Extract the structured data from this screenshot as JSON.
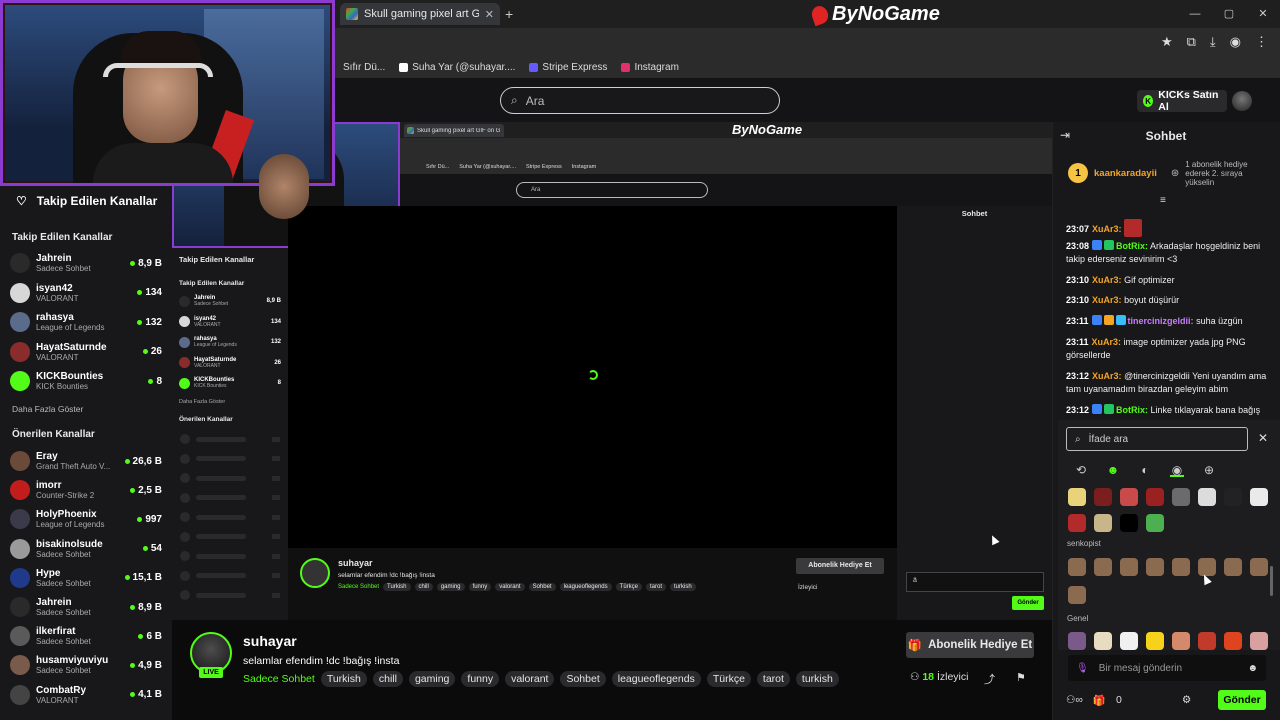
{
  "browser": {
    "tab_title": "Skull gaming pixel art GIF on G",
    "new_tab": "+",
    "brand": "ByNoGame",
    "bookmarks": [
      "Sıfır Dü...",
      "Suha Yar (@suhayar....",
      "Stripe Express",
      "Instagram"
    ],
    "window_controls": [
      "—",
      "▢",
      "✕"
    ]
  },
  "header": {
    "search_placeholder": "Ara",
    "kicks_button": "KICKs Satın Al"
  },
  "sidebar": {
    "title": "Takip Edilen Kanallar",
    "followed_label": "Takip Edilen Kanallar",
    "followed": [
      {
        "name": "Jahrein",
        "category": "Sadece Sohbet",
        "viewers": "8,9 B",
        "color": "#2a2a2a"
      },
      {
        "name": "isyan42",
        "category": "VALORANT",
        "viewers": "134",
        "color": "#d7d7d7"
      },
      {
        "name": "rahasya",
        "category": "League of Legends",
        "viewers": "132",
        "color": "#5a6b8c"
      },
      {
        "name": "HayatSaturnde",
        "category": "VALORANT",
        "viewers": "26",
        "color": "#8a2c2c"
      },
      {
        "name": "KICKBounties",
        "category": "KICK Bounties",
        "viewers": "8",
        "color": "#53fc18"
      }
    ],
    "show_more": "Daha Fazla Göster",
    "recommended_label": "Önerilen Kanallar",
    "recommended": [
      {
        "name": "Eray",
        "category": "Grand Theft Auto V...",
        "viewers": "26,6 B",
        "color": "#6b4a3a"
      },
      {
        "name": "imorr",
        "category": "Counter-Strike 2",
        "viewers": "2,5 B",
        "color": "#c21d1d"
      },
      {
        "name": "HolyPhoenix",
        "category": "League of Legends",
        "viewers": "997",
        "color": "#3a3a4a"
      },
      {
        "name": "bisakinolsude",
        "category": "Sadece Sohbet",
        "viewers": "54",
        "color": "#9a9a9a"
      },
      {
        "name": "Hype",
        "category": "Sadece Sohbet",
        "viewers": "15,1 B",
        "color": "#1f3a8a"
      },
      {
        "name": "Jahrein",
        "category": "Sadece Sohbet",
        "viewers": "8,9 B",
        "color": "#2a2a2a"
      },
      {
        "name": "ilkerfirat",
        "category": "Sadece Sohbet",
        "viewers": "6 B",
        "color": "#5a5a5a"
      },
      {
        "name": "husamviyuviyu",
        "category": "Sadece Sohbet",
        "viewers": "4,9 B",
        "color": "#7a5a4a"
      },
      {
        "name": "CombatRy",
        "category": "VALORANT",
        "viewers": "4,1 B",
        "color": "#444"
      }
    ]
  },
  "nested": {
    "tab_title": "Skull gaming pixel art GIF on G",
    "brand": "ByNoGame",
    "bookmarks": [
      "Sıfır Dü...",
      "Suha Yar (@suhayar....",
      "Stripe Express",
      "Instagram"
    ],
    "search": "Ara",
    "sidebar_title": "Takip Edilen Kanallar",
    "followed_label": "Takip Edilen Kanallar",
    "show_more": "Daha Fazla Göster",
    "recommended_label": "Önerilen Kanallar",
    "chat_title": "Sohbet",
    "chat_input": "ä",
    "send": "Gönder",
    "sub_button": "Abonelik Hediye Et",
    "viewers": "İzleyici",
    "streamer": "suhayar",
    "title": "selamlar efendim !dc !bağış !insta",
    "category": "Sadece Sohbet",
    "tags": [
      "Turkish",
      "chill",
      "gaming",
      "funny",
      "valorant",
      "Sohbet",
      "leagueoflegends",
      "Türkçe",
      "tarot",
      "turkish"
    ],
    "live": "LIVE"
  },
  "stream": {
    "streamer": "suhayar",
    "live": "LIVE",
    "title": "selamlar efendim !dc !bağış !insta",
    "category": "Sadece Sohbet",
    "tags": [
      "Turkish",
      "chill",
      "gaming",
      "funny",
      "valorant",
      "Sohbet",
      "leagueoflegends",
      "Türkçe",
      "tarot",
      "turkish"
    ],
    "sub_button": "Abonelik Hediye Et",
    "viewer_count": "18",
    "viewer_label": "İzleyici"
  },
  "chat": {
    "title": "Sohbet",
    "gifter": {
      "rank": "1",
      "name": "kaankaradayii",
      "text": "1 abonelik hediye ederek 2. sıraya yükselin"
    },
    "messages": [
      {
        "time": "23:07",
        "user": "XuAr3:",
        "color": "#f5a524",
        "text": ""
      },
      {
        "time": "23:08",
        "user": "BotRix:",
        "color": "#53fc18",
        "text": "Arkadaşlar hoşgeldiniz beni takip ederseniz sevinirim <3"
      },
      {
        "time": "23:10",
        "user": "XuAr3:",
        "color": "#f5a524",
        "text": "Gif optimizer"
      },
      {
        "time": "23:10",
        "user": "XuAr3:",
        "color": "#f5a524",
        "text": "boyut düşürür"
      },
      {
        "time": "23:11",
        "user": "tinercinizgeldii:",
        "color": "#c77dff",
        "text": "suha üzgün"
      },
      {
        "time": "23:11",
        "user": "XuAr3:",
        "color": "#f5a524",
        "text": "image optimizer yada jpg PNG görsellerde"
      },
      {
        "time": "23:12",
        "user": "XuAr3:",
        "color": "#f5a524",
        "text": "@tinercinizgeldii Yeni uyandım ama tam uyanamadım birazdan geleyim abim"
      },
      {
        "time": "23:12",
        "user": "BotRix:",
        "color": "#53fc18",
        "text": "Linke tıklayarak bana bağış"
      }
    ],
    "emote_search_placeholder": "İfade ara",
    "emote_sections": [
      "senkopist",
      "Genel"
    ],
    "input_placeholder": "Bir mesaj gönderin",
    "points": "0",
    "send": "Gönder"
  }
}
